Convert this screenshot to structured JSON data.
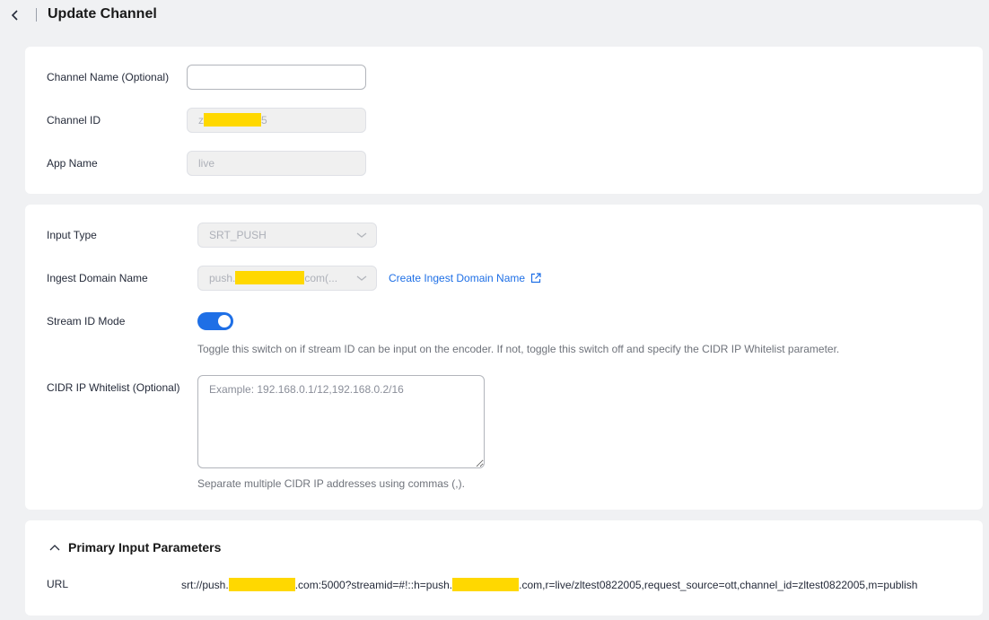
{
  "header": {
    "title": "Update Channel"
  },
  "basic": {
    "channel_name_label": "Channel Name (Optional)",
    "channel_name_value": "",
    "channel_id_label": "Channel ID",
    "channel_id_prefix": "z",
    "channel_id_suffix": "5",
    "app_name_label": "App Name",
    "app_name_value": "live"
  },
  "input": {
    "input_type_label": "Input Type",
    "input_type_value": "SRT_PUSH",
    "ingest_domain_label": "Ingest Domain Name",
    "ingest_domain_prefix": "push.",
    "ingest_domain_suffix": "com(...",
    "create_domain_link": "Create Ingest Domain Name",
    "stream_id_label": "Stream ID Mode",
    "stream_id_on": true,
    "stream_id_hint": "Toggle this switch on if stream ID can be input on the encoder. If not, toggle this switch off and specify the CIDR IP Whitelist parameter.",
    "cidr_label": "CIDR IP Whitelist (Optional)",
    "cidr_placeholder": "Example: 192.168.0.1/12,192.168.0.2/16",
    "cidr_hint": "Separate multiple CIDR IP addresses using commas (,)."
  },
  "primary": {
    "section_title": "Primary Input Parameters",
    "url_label": "URL",
    "url_part1": "srt://push.",
    "url_part2": ".com:5000?streamid=#!::h=push.",
    "url_part3": ".com,r=live/zltest0822005,request_source=ott,channel_id=zltest0822005,m=publish"
  },
  "colors": {
    "accent": "#1e6fe6",
    "redaction": "#ffd800"
  }
}
